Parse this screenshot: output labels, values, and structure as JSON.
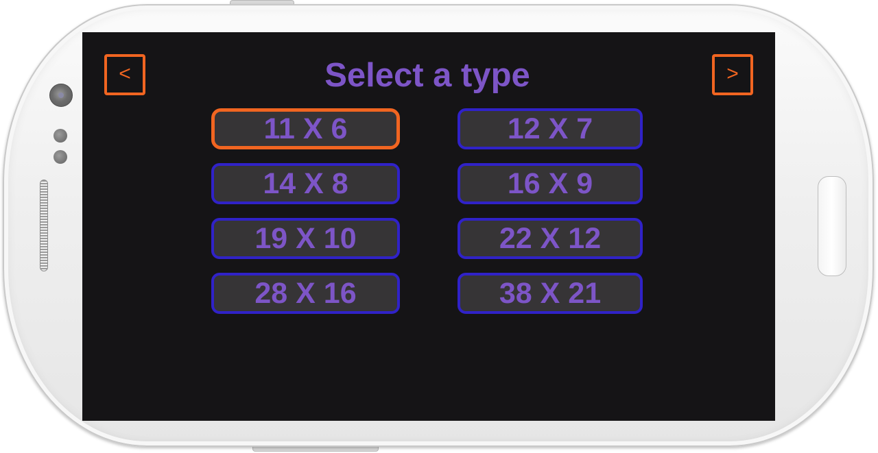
{
  "screen": {
    "title": "Select a type",
    "prev_label": "<",
    "next_label": ">",
    "types": [
      {
        "label": "11 X 6",
        "selected": true
      },
      {
        "label": "12 X 7",
        "selected": false
      },
      {
        "label": "14 X 8",
        "selected": false
      },
      {
        "label": "16 X 9",
        "selected": false
      },
      {
        "label": "19 X 10",
        "selected": false
      },
      {
        "label": "22 X 12",
        "selected": false
      },
      {
        "label": "28 X 16",
        "selected": false
      },
      {
        "label": "38 X 21",
        "selected": false
      }
    ]
  },
  "colors": {
    "accent": "#f16521",
    "text": "#7d55c7",
    "button_border": "#3022c8",
    "button_fill": "#363436",
    "screen_bg": "#151416"
  }
}
